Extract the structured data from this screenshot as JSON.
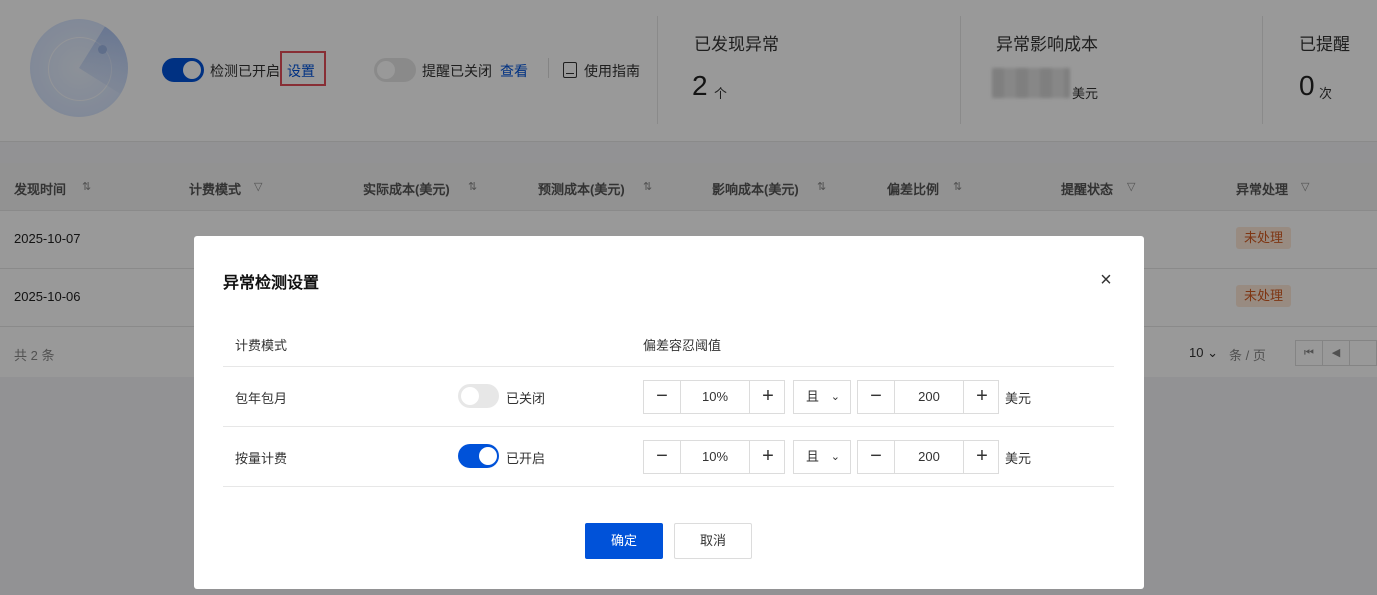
{
  "header": {
    "detection_toggle": {
      "state": "on",
      "label": "检测已开启",
      "link": "设置"
    },
    "alert_toggle": {
      "state": "off",
      "label": "提醒已关闭",
      "link": "查看"
    },
    "guide": "使用指南"
  },
  "stats": [
    {
      "title": "已发现异常",
      "value": "2",
      "unit": "个"
    },
    {
      "title": "异常影响成本",
      "value": "",
      "unit": "美元"
    },
    {
      "title": "已提醒",
      "value": "0",
      "unit": "次"
    }
  ],
  "table": {
    "columns": [
      "发现时间",
      "计费模式",
      "实际成本(美元)",
      "预测成本(美元)",
      "影响成本(美元)",
      "偏差比例",
      "提醒状态",
      "异常处理"
    ],
    "column_icons": [
      "sort-icon",
      "filter-icon",
      "sort-icon",
      "sort-icon",
      "sort-icon",
      "sort-icon",
      "filter-icon",
      "filter-icon"
    ],
    "rows": [
      {
        "date": "2025-10-07",
        "status": "未处理"
      },
      {
        "date": "2025-10-06",
        "status": "未处理"
      }
    ],
    "status_color": "#d35a21",
    "footer": {
      "total": "共 2 条",
      "page_size": "10",
      "page_size_unit": "条 / 页"
    }
  },
  "dialog": {
    "title": "异常检测设置",
    "col_mode": "计费模式",
    "col_threshold": "偏差容忍阈值",
    "rows": [
      {
        "mode": "包年包月",
        "toggle": "off",
        "state_text": "已关闭",
        "percent": "10%",
        "logic": "且",
        "amount": "200",
        "unit": "美元"
      },
      {
        "mode": "按量计费",
        "toggle": "on",
        "state_text": "已开启",
        "percent": "10%",
        "logic": "且",
        "amount": "200",
        "unit": "美元"
      }
    ],
    "ok": "确定",
    "cancel": "取消",
    "accent": "#0052d9"
  }
}
